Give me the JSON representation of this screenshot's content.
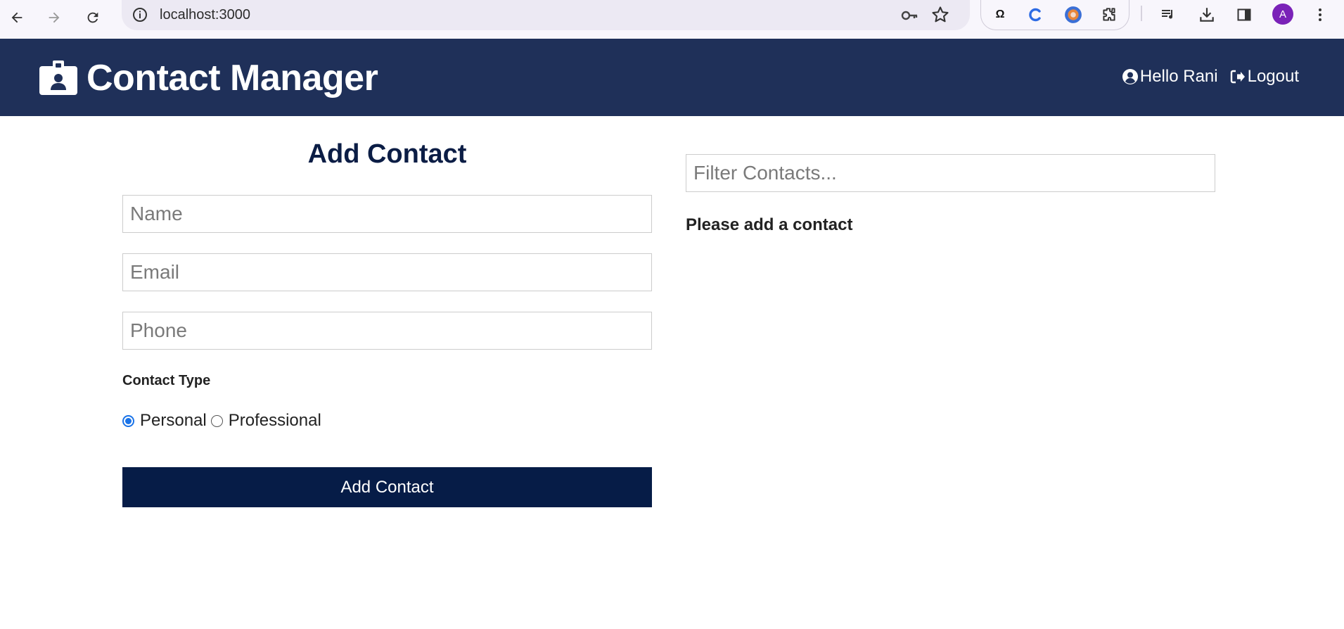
{
  "browser": {
    "url": "localhost:3000",
    "ext_omega_label": "Ω",
    "profile_initial": "A"
  },
  "app": {
    "title": "Contact Manager",
    "user_greeting": "Hello Rani",
    "logout_label": "Logout"
  },
  "form": {
    "title": "Add Contact",
    "name_placeholder": "Name",
    "email_placeholder": "Email",
    "phone_placeholder": "Phone",
    "type_label": "Contact Type",
    "type_options": [
      "Personal",
      "Professional"
    ],
    "selected_type": "Personal",
    "submit_label": "Add Contact"
  },
  "contacts": {
    "filter_placeholder": "Filter Contacts...",
    "empty_message": "Please add a contact"
  },
  "colors": {
    "navbar": "#1f3059",
    "submit_button": "#061c47",
    "form_title": "#0b1d45",
    "radio_accent": "#1a73e8"
  }
}
